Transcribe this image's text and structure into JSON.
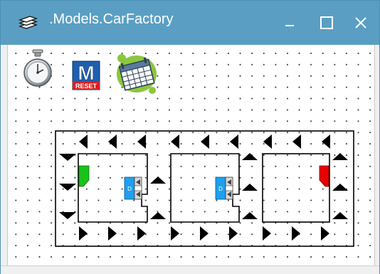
{
  "window": {
    "title": ".Models.CarFactory",
    "app_icon": "stacked-layers-icon",
    "controls": [
      "minimize-icon",
      "maximize-icon",
      "close-icon"
    ]
  },
  "toolbar": {
    "icons": [
      "stopwatch-icon",
      "model-reset-icon",
      "calendar-icon"
    ],
    "reset_label": "RESET",
    "model_letter": "M"
  },
  "model": {
    "station_label": "D",
    "colors": {
      "track": "#000000",
      "green_block": "#19c219",
      "red_block": "#e80000",
      "station": "#1ea0f0"
    }
  }
}
